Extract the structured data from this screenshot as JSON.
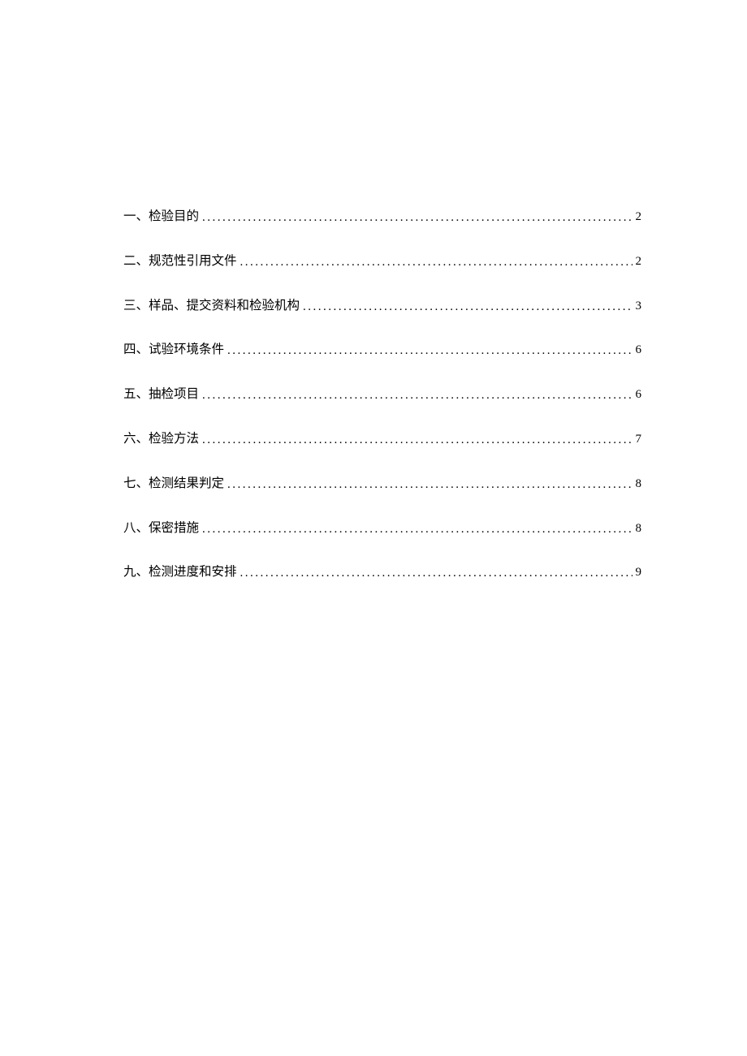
{
  "toc": {
    "entries": [
      {
        "title": "一、检验目的",
        "page": "2"
      },
      {
        "title": "二、规范性引用文件",
        "page": "2"
      },
      {
        "title": "三、样品、提交资料和检验机构",
        "page": "3"
      },
      {
        "title": "四、试验环境条件",
        "page": "6"
      },
      {
        "title": "五、抽检项目",
        "page": "6"
      },
      {
        "title": "六、检验方法",
        "page": "7"
      },
      {
        "title": "七、检测结果判定",
        "page": "8"
      },
      {
        "title": "八、保密措施",
        "page": "8"
      },
      {
        "title": "九、检测进度和安排",
        "page": "9"
      }
    ]
  }
}
